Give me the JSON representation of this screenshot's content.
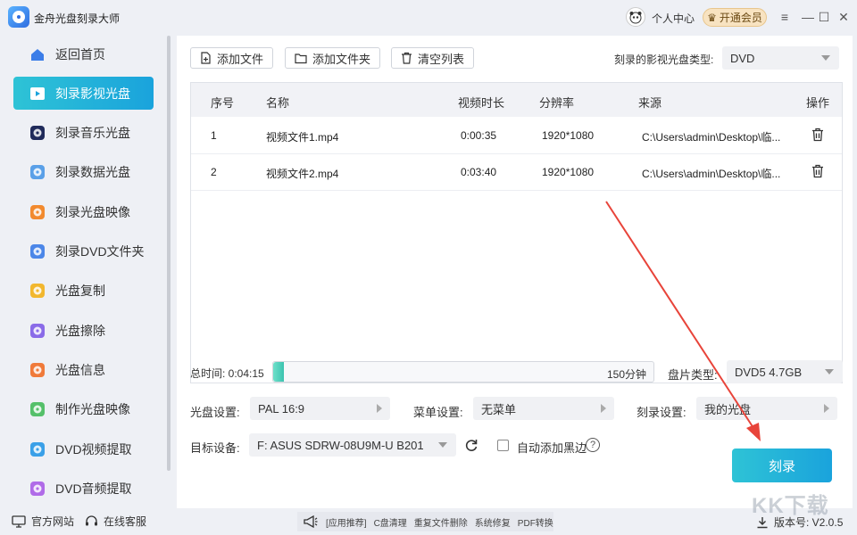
{
  "app": {
    "title": "金舟光盘刻录大师"
  },
  "header": {
    "user_center": "个人中心",
    "vip": "开通会员",
    "vip_icon": "crown-icon"
  },
  "sidebar": {
    "items": [
      {
        "label": "返回首页",
        "icon": "home-icon",
        "color": "#3b7de8"
      },
      {
        "label": "刻录影视光盘",
        "icon": "video-disc-icon",
        "color": "#ffffff"
      },
      {
        "label": "刻录音乐光盘",
        "icon": "music-disc-icon",
        "color": "#1f2a5a"
      },
      {
        "label": "刻录数据光盘",
        "icon": "data-disc-icon",
        "color": "#5aa0e8"
      },
      {
        "label": "刻录光盘映像",
        "icon": "disc-image-icon",
        "color": "#f28a2e"
      },
      {
        "label": "刻录DVD文件夹",
        "icon": "dvd-folder-icon",
        "color": "#4b86e8"
      },
      {
        "label": "光盘复制",
        "icon": "disc-copy-icon",
        "color": "#f2b72e"
      },
      {
        "label": "光盘擦除",
        "icon": "disc-erase-icon",
        "color": "#8a6be8"
      },
      {
        "label": "光盘信息",
        "icon": "disc-info-icon",
        "color": "#f07a3a"
      },
      {
        "label": "制作光盘映像",
        "icon": "make-image-icon",
        "color": "#55c06a"
      },
      {
        "label": "DVD视频提取",
        "icon": "dvd-video-extract-icon",
        "color": "#3aa0e8"
      },
      {
        "label": "DVD音频提取",
        "icon": "dvd-audio-extract-icon",
        "color": "#b06be8"
      }
    ],
    "active_index": 1
  },
  "toolbar": {
    "add_file": "添加文件",
    "add_folder": "添加文件夹",
    "clear_list": "清空列表",
    "disc_type_label": "刻录的影视光盘类型:",
    "disc_type_value": "DVD"
  },
  "table": {
    "headers": [
      "序号",
      "名称",
      "视频时长",
      "分辨率",
      "来源",
      "操作"
    ],
    "rows": [
      {
        "index": "1",
        "name": "视频文件1.mp4",
        "duration": "0:00:35",
        "resolution": "1920*1080",
        "source": "C:\\Users\\admin\\Desktop\\临..."
      },
      {
        "index": "2",
        "name": "视频文件2.mp4",
        "duration": "0:03:40",
        "resolution": "1920*1080",
        "source": "C:\\Users\\admin\\Desktop\\临..."
      }
    ]
  },
  "summary": {
    "total_time": "总时间: 0:04:15",
    "capacity": "150分钟",
    "capacity_used_fraction": 0.028,
    "disc_type_label": "盘片类型:",
    "disc_type_value": "DVD5 4.7GB"
  },
  "settings": {
    "disc_label": "光盘设置:",
    "disc_value": "PAL 16:9",
    "menu_label": "菜单设置:",
    "menu_value": "无菜单",
    "burn_label": "刻录设置:",
    "burn_value": "我的光盘",
    "target_label": "目标设备:",
    "target_value": "F: ASUS SDRW-08U9M-U B201",
    "black_border": "自动添加黑边",
    "help": "?"
  },
  "actions": {
    "burn": "刻录"
  },
  "footer": {
    "website": "官方网站",
    "service": "在线客服",
    "promo_tag": "[应用推荐]",
    "promo_items": [
      "C盘清理",
      "重复文件删除",
      "系统修复",
      "PDF转换"
    ],
    "version": "版本号: V2.0.5"
  },
  "watermark": "KK下载"
}
